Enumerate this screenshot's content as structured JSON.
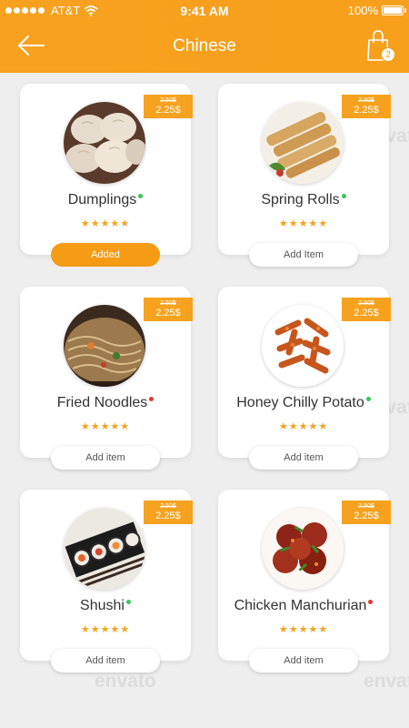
{
  "status_bar": {
    "carrier": "AT&T",
    "time": "9:41 AM",
    "battery": "100%",
    "battery_level": 1.0
  },
  "header": {
    "title": "Chinese",
    "cart_count": "2"
  },
  "colors": {
    "accent": "#f6a21e",
    "green_dot": "#34c759",
    "red_dot": "#e53935"
  },
  "items": [
    {
      "name": "Dumplings",
      "old_price": "2.50$",
      "price": "2.25$",
      "rating": 4.5,
      "stars": "★★★★★",
      "dot": "green",
      "button": "Added",
      "added": true
    },
    {
      "name": "Spring Rolls",
      "old_price": "2.50$",
      "price": "2.25$",
      "rating": 4.5,
      "stars": "★★★★★",
      "dot": "green",
      "button": "Add Item",
      "added": false
    },
    {
      "name": "Fried Noodles",
      "old_price": "2.50$",
      "price": "2.25$",
      "rating": 4.5,
      "stars": "★★★★★",
      "dot": "red",
      "button": "Add item",
      "added": false
    },
    {
      "name": "Honey Chilly Potato",
      "old_price": "2.50$",
      "price": "2.25$",
      "rating": 4.5,
      "stars": "★★★★★",
      "dot": "green",
      "button": "Add item",
      "added": false
    },
    {
      "name": "Shushi",
      "old_price": "2.50$",
      "price": "2.25$",
      "rating": 4.5,
      "stars": "★★★★★",
      "dot": "green",
      "button": "Add item",
      "added": false
    },
    {
      "name": "Chicken Manchurian",
      "old_price": "2.50$",
      "price": "2.25$",
      "rating": 4.5,
      "stars": "★★★★★",
      "dot": "red",
      "button": "Add item",
      "added": false
    }
  ],
  "watermark": "envato"
}
